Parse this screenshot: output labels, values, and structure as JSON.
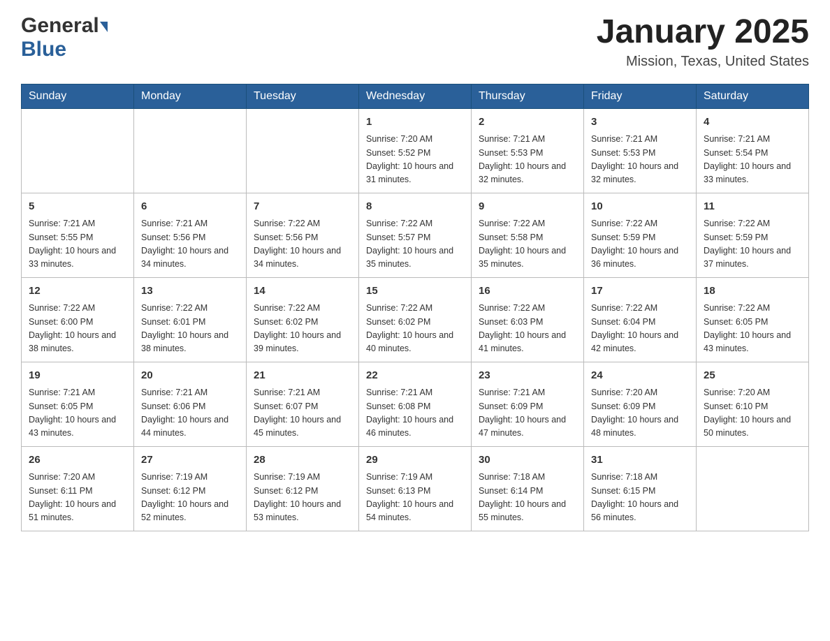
{
  "header": {
    "logo_general": "General",
    "logo_blue": "Blue",
    "month_title": "January 2025",
    "location": "Mission, Texas, United States"
  },
  "days_of_week": [
    "Sunday",
    "Monday",
    "Tuesday",
    "Wednesday",
    "Thursday",
    "Friday",
    "Saturday"
  ],
  "weeks": [
    [
      {
        "day": "",
        "info": ""
      },
      {
        "day": "",
        "info": ""
      },
      {
        "day": "",
        "info": ""
      },
      {
        "day": "1",
        "info": "Sunrise: 7:20 AM\nSunset: 5:52 PM\nDaylight: 10 hours\nand 31 minutes."
      },
      {
        "day": "2",
        "info": "Sunrise: 7:21 AM\nSunset: 5:53 PM\nDaylight: 10 hours\nand 32 minutes."
      },
      {
        "day": "3",
        "info": "Sunrise: 7:21 AM\nSunset: 5:53 PM\nDaylight: 10 hours\nand 32 minutes."
      },
      {
        "day": "4",
        "info": "Sunrise: 7:21 AM\nSunset: 5:54 PM\nDaylight: 10 hours\nand 33 minutes."
      }
    ],
    [
      {
        "day": "5",
        "info": "Sunrise: 7:21 AM\nSunset: 5:55 PM\nDaylight: 10 hours\nand 33 minutes."
      },
      {
        "day": "6",
        "info": "Sunrise: 7:21 AM\nSunset: 5:56 PM\nDaylight: 10 hours\nand 34 minutes."
      },
      {
        "day": "7",
        "info": "Sunrise: 7:22 AM\nSunset: 5:56 PM\nDaylight: 10 hours\nand 34 minutes."
      },
      {
        "day": "8",
        "info": "Sunrise: 7:22 AM\nSunset: 5:57 PM\nDaylight: 10 hours\nand 35 minutes."
      },
      {
        "day": "9",
        "info": "Sunrise: 7:22 AM\nSunset: 5:58 PM\nDaylight: 10 hours\nand 35 minutes."
      },
      {
        "day": "10",
        "info": "Sunrise: 7:22 AM\nSunset: 5:59 PM\nDaylight: 10 hours\nand 36 minutes."
      },
      {
        "day": "11",
        "info": "Sunrise: 7:22 AM\nSunset: 5:59 PM\nDaylight: 10 hours\nand 37 minutes."
      }
    ],
    [
      {
        "day": "12",
        "info": "Sunrise: 7:22 AM\nSunset: 6:00 PM\nDaylight: 10 hours\nand 38 minutes."
      },
      {
        "day": "13",
        "info": "Sunrise: 7:22 AM\nSunset: 6:01 PM\nDaylight: 10 hours\nand 38 minutes."
      },
      {
        "day": "14",
        "info": "Sunrise: 7:22 AM\nSunset: 6:02 PM\nDaylight: 10 hours\nand 39 minutes."
      },
      {
        "day": "15",
        "info": "Sunrise: 7:22 AM\nSunset: 6:02 PM\nDaylight: 10 hours\nand 40 minutes."
      },
      {
        "day": "16",
        "info": "Sunrise: 7:22 AM\nSunset: 6:03 PM\nDaylight: 10 hours\nand 41 minutes."
      },
      {
        "day": "17",
        "info": "Sunrise: 7:22 AM\nSunset: 6:04 PM\nDaylight: 10 hours\nand 42 minutes."
      },
      {
        "day": "18",
        "info": "Sunrise: 7:22 AM\nSunset: 6:05 PM\nDaylight: 10 hours\nand 43 minutes."
      }
    ],
    [
      {
        "day": "19",
        "info": "Sunrise: 7:21 AM\nSunset: 6:05 PM\nDaylight: 10 hours\nand 43 minutes."
      },
      {
        "day": "20",
        "info": "Sunrise: 7:21 AM\nSunset: 6:06 PM\nDaylight: 10 hours\nand 44 minutes."
      },
      {
        "day": "21",
        "info": "Sunrise: 7:21 AM\nSunset: 6:07 PM\nDaylight: 10 hours\nand 45 minutes."
      },
      {
        "day": "22",
        "info": "Sunrise: 7:21 AM\nSunset: 6:08 PM\nDaylight: 10 hours\nand 46 minutes."
      },
      {
        "day": "23",
        "info": "Sunrise: 7:21 AM\nSunset: 6:09 PM\nDaylight: 10 hours\nand 47 minutes."
      },
      {
        "day": "24",
        "info": "Sunrise: 7:20 AM\nSunset: 6:09 PM\nDaylight: 10 hours\nand 48 minutes."
      },
      {
        "day": "25",
        "info": "Sunrise: 7:20 AM\nSunset: 6:10 PM\nDaylight: 10 hours\nand 50 minutes."
      }
    ],
    [
      {
        "day": "26",
        "info": "Sunrise: 7:20 AM\nSunset: 6:11 PM\nDaylight: 10 hours\nand 51 minutes."
      },
      {
        "day": "27",
        "info": "Sunrise: 7:19 AM\nSunset: 6:12 PM\nDaylight: 10 hours\nand 52 minutes."
      },
      {
        "day": "28",
        "info": "Sunrise: 7:19 AM\nSunset: 6:12 PM\nDaylight: 10 hours\nand 53 minutes."
      },
      {
        "day": "29",
        "info": "Sunrise: 7:19 AM\nSunset: 6:13 PM\nDaylight: 10 hours\nand 54 minutes."
      },
      {
        "day": "30",
        "info": "Sunrise: 7:18 AM\nSunset: 6:14 PM\nDaylight: 10 hours\nand 55 minutes."
      },
      {
        "day": "31",
        "info": "Sunrise: 7:18 AM\nSunset: 6:15 PM\nDaylight: 10 hours\nand 56 minutes."
      },
      {
        "day": "",
        "info": ""
      }
    ]
  ]
}
